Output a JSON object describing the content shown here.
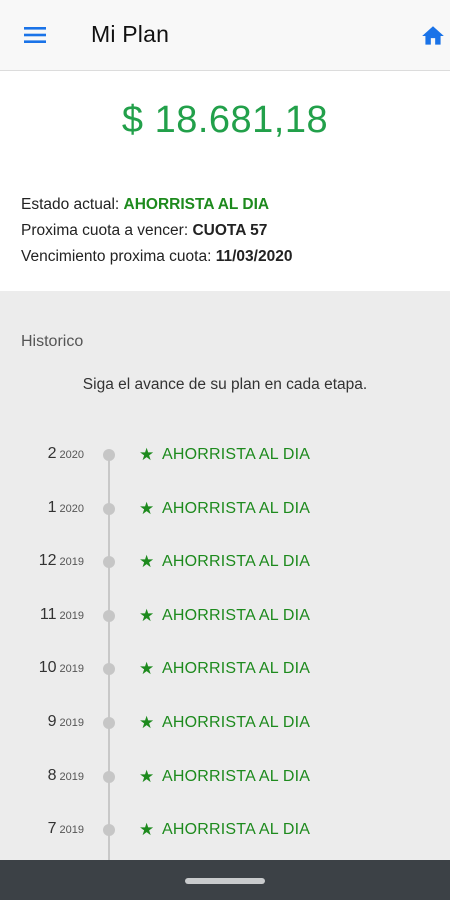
{
  "appbar": {
    "title": "Mi Plan",
    "menu_icon": "hamburger-menu-icon",
    "home_icon": "home-icon",
    "accent_color": "#1a73e8"
  },
  "summary": {
    "amount": "$ 18.681,18",
    "amount_color": "#22a04a",
    "estado_label": "Estado actual: ",
    "estado_value": "AHORRISTA AL DIA",
    "proxima_label": "Proxima cuota a vencer: ",
    "proxima_value": "CUOTA 57",
    "venc_label": "Vencimiento proxima cuota: ",
    "venc_value": "11/03/2020"
  },
  "history": {
    "title": "Historico",
    "subtitle": "Siga el avance de su plan en cada etapa.",
    "star_icon": "star-icon",
    "items": [
      {
        "month": "2",
        "year": "2020",
        "status": "AHORRISTA AL DIA"
      },
      {
        "month": "1",
        "year": "2020",
        "status": "AHORRISTA AL DIA"
      },
      {
        "month": "12",
        "year": "2019",
        "status": "AHORRISTA AL DIA"
      },
      {
        "month": "11",
        "year": "2019",
        "status": "AHORRISTA AL DIA"
      },
      {
        "month": "10",
        "year": "2019",
        "status": "AHORRISTA AL DIA"
      },
      {
        "month": "9",
        "year": "2019",
        "status": "AHORRISTA AL DIA"
      },
      {
        "month": "8",
        "year": "2019",
        "status": "AHORRISTA AL DIA"
      },
      {
        "month": "7",
        "year": "2019",
        "status": "AHORRISTA AL DIA"
      }
    ]
  },
  "colors": {
    "status_green": "#1d8a1d",
    "history_bg": "#ececec",
    "navbar_bg": "#3c4146"
  }
}
